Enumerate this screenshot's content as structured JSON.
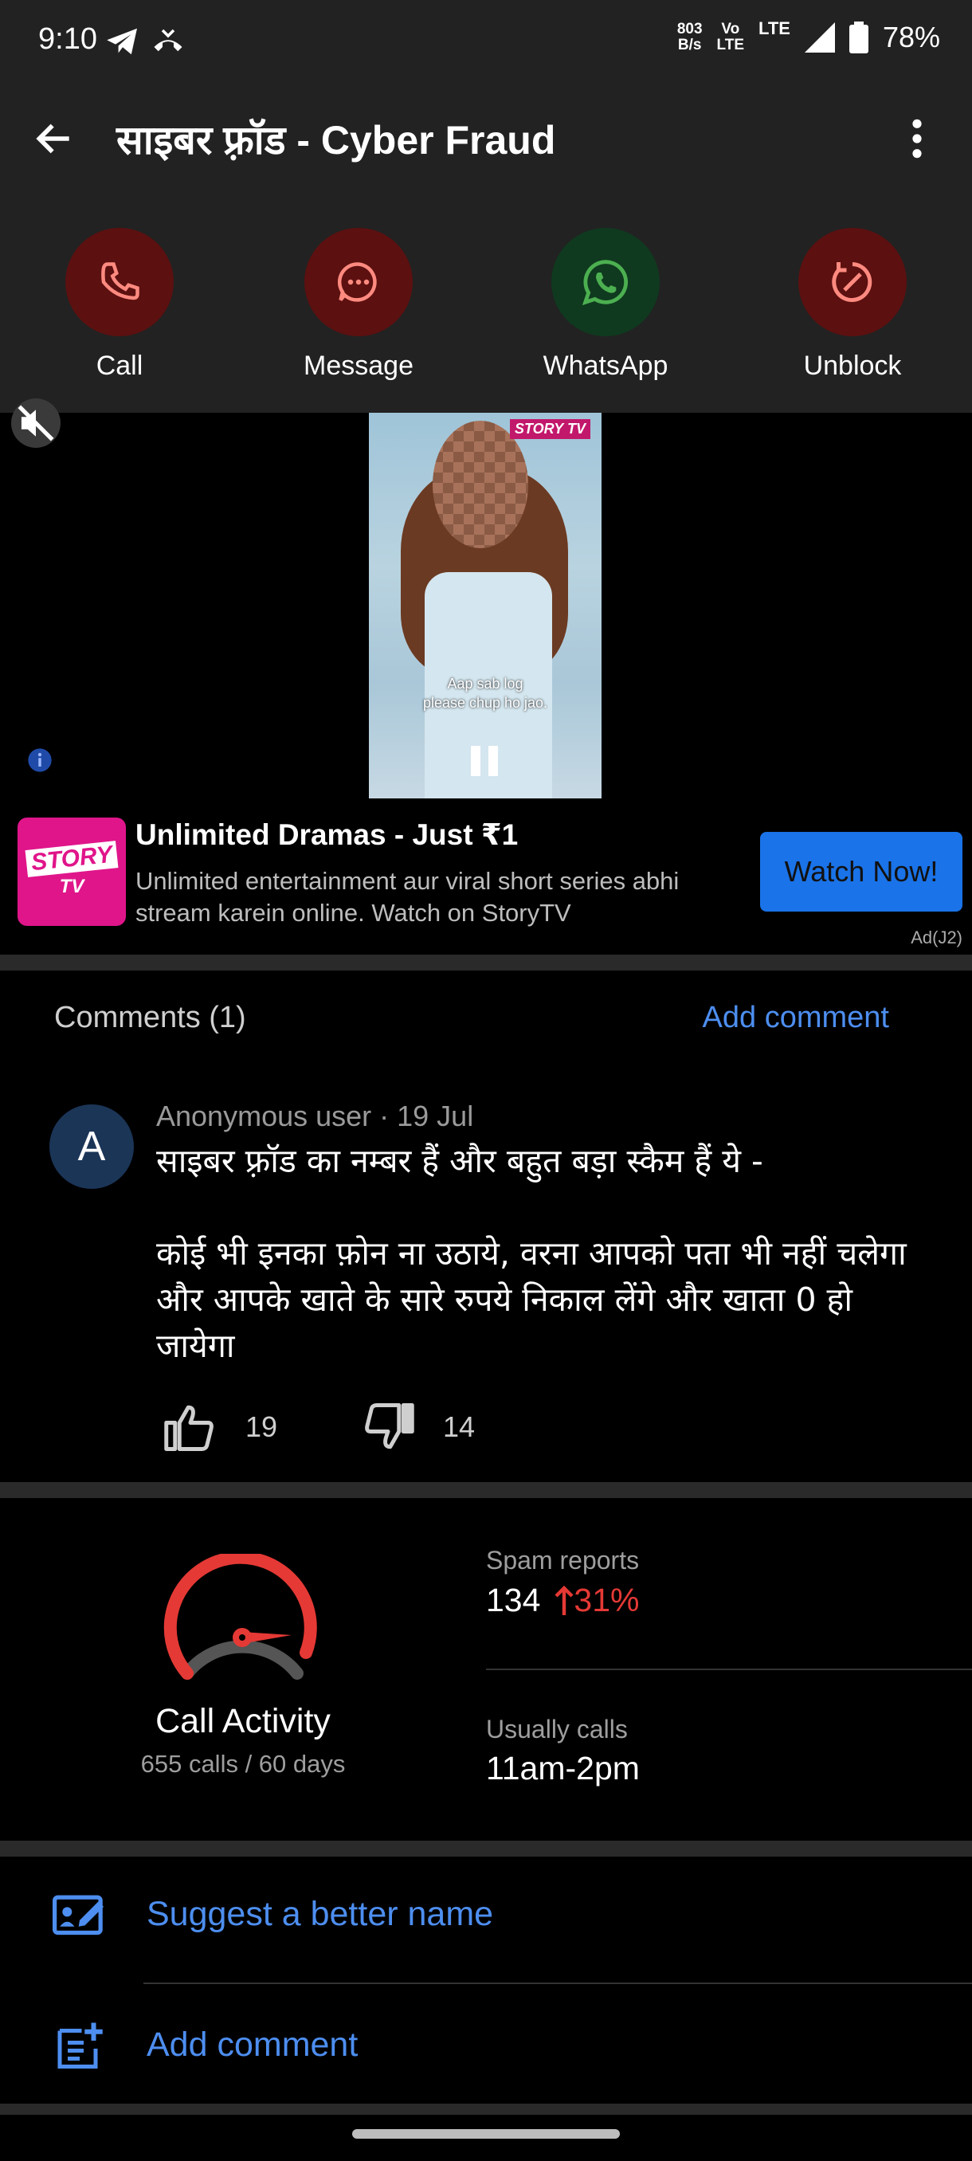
{
  "status": {
    "time": "9:10",
    "net_speed_top": "803",
    "net_speed_bottom": "B/s",
    "volte_top": "Vo",
    "volte_bottom": "LTE",
    "lte": "LTE",
    "battery": "78%"
  },
  "appbar": {
    "title": "साइबर फ़्रॉड - Cyber Fraud"
  },
  "actions": [
    {
      "label": "Call",
      "color": "#5c1010",
      "icon_color": "#ff8a80"
    },
    {
      "label": "Message",
      "color": "#5c1010",
      "icon_color": "#ff8a80"
    },
    {
      "label": "WhatsApp",
      "color": "#0f3a1f",
      "icon_color": "#4caf50"
    },
    {
      "label": "Unblock",
      "color": "#5c1010",
      "icon_color": "#ff8a80"
    }
  ],
  "ad": {
    "video_caption_1": "Aap sab log",
    "video_caption_2": "please chup ho jao.",
    "video_logo": "STORY TV",
    "logo_line1": "STORY",
    "logo_line2": "TV",
    "title": "Unlimited Dramas - Just ₹1",
    "description": "Unlimited entertainment aur viral short series abhi stream karein online. Watch on StoryTV",
    "cta": "Watch Now!",
    "tag": "Ad(J2)"
  },
  "comments": {
    "header": "Comments (1)",
    "add_label": "Add comment",
    "items": [
      {
        "avatar": "A",
        "meta": "Anonymous user · 19 Jul",
        "para1": "साइबर फ़्रॉड का नम्बर हैं और बहुत बड़ा स्कैम हैं ये -",
        "para2": "कोई भी इनका फ़ोन ना उठाये, वरना आपको पता भी नहीं चलेगा और आपके खाते के सारे रुपये निकाल लेंगे और खाता 0 हो जायेगा",
        "likes": "19",
        "dislikes": "14"
      }
    ]
  },
  "activity": {
    "title": "Call Activity",
    "subtitle": "655 calls / 60 days",
    "spam_label": "Spam reports",
    "spam_value": "134",
    "spam_change": "31%",
    "usual_label": "Usually calls",
    "usual_value": "11am-2pm",
    "gauge_color": "#e53935"
  },
  "bottom_actions": {
    "suggest": "Suggest a better name",
    "add_comment": "Add comment"
  },
  "accent": "#4d8ef0"
}
